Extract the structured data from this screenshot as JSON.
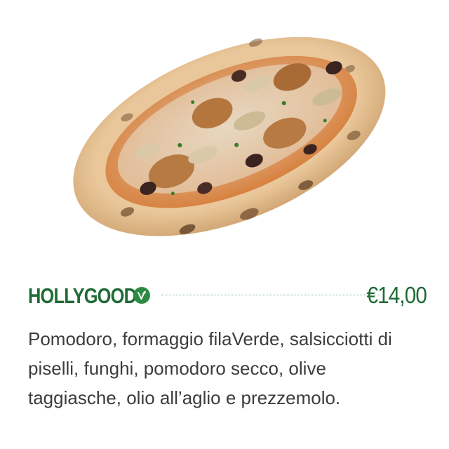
{
  "product": {
    "image_alt": "Pizza Hollygood",
    "name": "HOLLYGOOD",
    "badge_icon": "vegan-leaf-icon",
    "price": "€14,00",
    "description": "Pomodoro, formaggio filaVerde, salsicciotti di piselli, funghi, pomodoro secco, olive taggiasche, olio all’aglio e prezzemolo."
  },
  "colors": {
    "brand_green": "#1f6b35",
    "badge_green": "#2c8a43",
    "text": "#3c3c3c"
  }
}
